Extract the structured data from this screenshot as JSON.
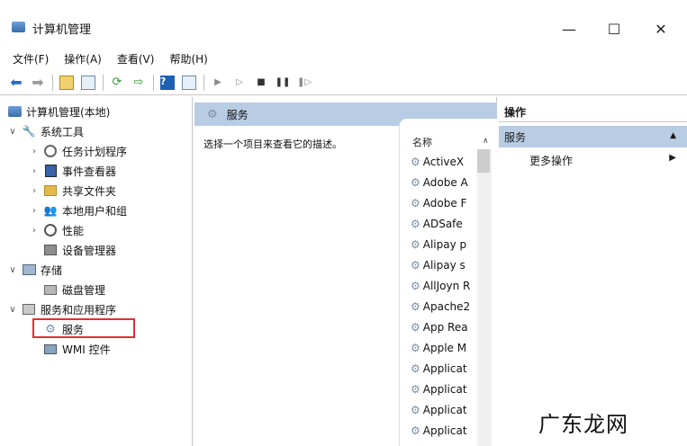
{
  "window": {
    "title": "计算机管理",
    "minimize_glyph": "—",
    "maximize_glyph": "☐",
    "close_glyph": "✕"
  },
  "menu": [
    "文件(F)",
    "操作(A)",
    "查看(V)",
    "帮助(H)"
  ],
  "tree": {
    "root": "计算机管理(本地)",
    "system_tools": "系统工具",
    "task_scheduler": "任务计划程序",
    "event_viewer": "事件查看器",
    "shared_folders": "共享文件夹",
    "local_users": "本地用户和组",
    "performance": "性能",
    "device_manager": "设备管理器",
    "storage": "存储",
    "disk_management": "磁盘管理",
    "services_apps": "服务和应用程序",
    "services": "服务",
    "wmi": "WMI 控件"
  },
  "middle": {
    "header": "服务",
    "description": "选择一个项目来查看它的描述。",
    "column_name": "名称",
    "services": [
      "ActiveX",
      "Adobe A",
      "Adobe F",
      "ADSafe",
      "Alipay p",
      "Alipay s",
      "AllJoyn R",
      "Apache2",
      "App Rea",
      "Apple M",
      "Applicat",
      "Applicat",
      "Applicat",
      "Applicat"
    ]
  },
  "actions": {
    "title": "操作",
    "section": "服务",
    "more": "更多操作"
  },
  "watermark": "广东龙网",
  "colors": {
    "selection_blue": "#b8cce4",
    "highlight_red": "#e03030"
  }
}
